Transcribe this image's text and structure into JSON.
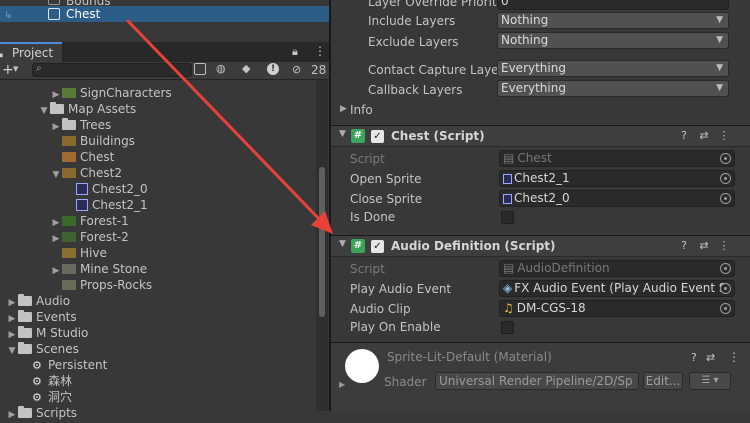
{
  "hierarchy": {
    "bounds_label": "Bounds",
    "selected_label": "Chest"
  },
  "project": {
    "tab_label": "Project",
    "toolbar": {
      "add": "+",
      "eye_count": "28",
      "search_placeholder": ""
    },
    "tree": [
      {
        "label": "SignCharacters",
        "kind": "sprite",
        "indent": 50,
        "arrow": "▶"
      },
      {
        "label": "Map Assets",
        "kind": "folder",
        "indent": 38,
        "arrow": "▼"
      },
      {
        "label": "Trees",
        "kind": "folder",
        "indent": 50,
        "arrow": "▶"
      },
      {
        "label": "Buildings",
        "kind": "sprite",
        "indent": 50,
        "arrow": ""
      },
      {
        "label": "Chest",
        "kind": "sprite",
        "indent": 50,
        "arrow": ""
      },
      {
        "label": "Chest2",
        "kind": "sprite",
        "indent": 50,
        "arrow": "▼"
      },
      {
        "label": "Chest2_0",
        "kind": "sub",
        "indent": 64,
        "arrow": ""
      },
      {
        "label": "Chest2_1",
        "kind": "sub",
        "indent": 64,
        "arrow": ""
      },
      {
        "label": "Forest-1",
        "kind": "sprite",
        "indent": 50,
        "arrow": "▶"
      },
      {
        "label": "Forest-2",
        "kind": "sprite",
        "indent": 50,
        "arrow": "▶"
      },
      {
        "label": "Hive",
        "kind": "sprite",
        "indent": 50,
        "arrow": ""
      },
      {
        "label": "Mine Stone",
        "kind": "sprite",
        "indent": 50,
        "arrow": "▶"
      },
      {
        "label": "Props-Rocks",
        "kind": "sprite",
        "indent": 50,
        "arrow": ""
      },
      {
        "label": "Audio",
        "kind": "folder",
        "indent": 6,
        "arrow": "▶"
      },
      {
        "label": "Events",
        "kind": "folder",
        "indent": 6,
        "arrow": "▶"
      },
      {
        "label": "M Studio",
        "kind": "folder",
        "indent": 6,
        "arrow": "▶"
      },
      {
        "label": "Scenes",
        "kind": "folder",
        "indent": 6,
        "arrow": "▼"
      },
      {
        "label": "Persistent",
        "kind": "unity",
        "indent": 20,
        "arrow": ""
      },
      {
        "label": "森林",
        "kind": "unity",
        "indent": 20,
        "arrow": ""
      },
      {
        "label": "洞穴",
        "kind": "unity",
        "indent": 20,
        "arrow": ""
      },
      {
        "label": "Scripts",
        "kind": "folder",
        "indent": 6,
        "arrow": "▶"
      }
    ]
  },
  "inspector": {
    "layer_override_priority": {
      "label": "Layer Override Priority",
      "value": "0"
    },
    "include_layers": {
      "label": "Include Layers",
      "value": "Nothing"
    },
    "exclude_layers": {
      "label": "Exclude Layers",
      "value": "Nothing"
    },
    "contact_capture": {
      "label": "Contact Capture Layer",
      "value": "Everything"
    },
    "callback_layers": {
      "label": "Callback Layers",
      "value": "Everything"
    },
    "info_label": "Info",
    "chest_script": {
      "title": "Chest (Script)",
      "script_label": "Script",
      "script_value": "Chest",
      "open_label": "Open Sprite",
      "open_value": "Chest2_1",
      "close_label": "Close Sprite",
      "close_value": "Chest2_0",
      "isdone_label": "Is Done"
    },
    "audio_script": {
      "title": "Audio Definition (Script)",
      "script_label": "Script",
      "script_value": "AudioDefinition",
      "event_label": "Play Audio Event",
      "event_value": "FX Audio Event (Play Audio Event S",
      "clip_label": "Audio Clip",
      "clip_value": "DM-CGS-18",
      "onenable_label": "Play On Enable"
    },
    "material": {
      "title": "Sprite-Lit-Default (Material)",
      "shader_label": "Shader",
      "shader_value": "Universal Render Pipeline/2D/Sp",
      "edit_label": "Edit..."
    }
  },
  "colors": {
    "selection": "#2c5d87",
    "script_icon": "#3aa55a",
    "arrow": "#e8413a"
  }
}
